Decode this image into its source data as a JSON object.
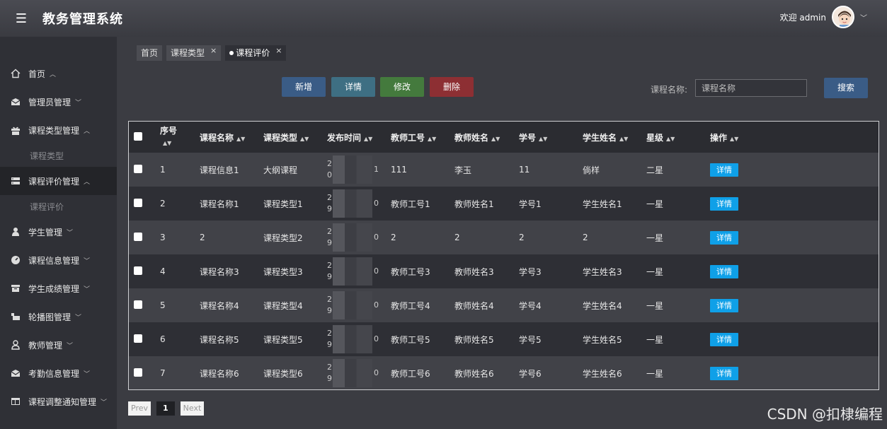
{
  "header": {
    "menu_icon": "hamburger-icon",
    "title": "教务管理系统",
    "welcome": "欢迎 admin"
  },
  "sidebar": {
    "items": [
      {
        "label": "首页",
        "icon": "home-icon",
        "caret": "^"
      },
      {
        "label": "管理员管理",
        "icon": "mail-icon",
        "caret": "v"
      },
      {
        "label": "课程类型管理",
        "icon": "gift-icon",
        "caret": "^"
      },
      {
        "label": "课程类型",
        "sub": true
      },
      {
        "label": "课程评价管理",
        "icon": "server-icon",
        "caret": "^"
      },
      {
        "label": "课程评价",
        "sub": true
      },
      {
        "label": "学生管理",
        "icon": "user-icon",
        "caret": "v"
      },
      {
        "label": "课程信息管理",
        "icon": "gauge-icon",
        "caret": "v"
      },
      {
        "label": "学生成绩管理",
        "icon": "box-icon",
        "caret": "v"
      },
      {
        "label": "轮播图管理",
        "icon": "image-icon",
        "caret": "v"
      },
      {
        "label": "教师管理",
        "icon": "person-icon",
        "caret": "v"
      },
      {
        "label": "考勤信息管理",
        "icon": "mail-icon",
        "caret": "v"
      },
      {
        "label": "课程调整通知管理",
        "icon": "window-icon",
        "caret": "v"
      }
    ]
  },
  "tabs": [
    {
      "label": "首页"
    },
    {
      "label": "课程类型"
    },
    {
      "label": "课程评价"
    }
  ],
  "toolbar": {
    "add": "新增",
    "detail": "详情",
    "edit": "修改",
    "delete": "删除",
    "search_label": "课程名称:",
    "search_placeholder": "课程名称",
    "search": "搜索"
  },
  "table": {
    "headers": [
      "序号",
      "课程名称",
      "课程类型",
      "发布时间",
      "教师工号",
      "教师姓名",
      "学号",
      "学生姓名",
      "星级",
      "操作"
    ],
    "action_label": "详情",
    "rows": [
      {
        "id": "1",
        "course": "课程信息1",
        "type": "大纲课程",
        "time_a": "2",
        "time_b": "0",
        "time_c": "1",
        "tno": "111",
        "tname": "李玉",
        "sno": "11",
        "sname": "倘样",
        "star": "二星"
      },
      {
        "id": "2",
        "course": "课程名称1",
        "type": "课程类型1",
        "time_a": "2",
        "time_b": "9",
        "time_c": "0",
        "tno": "教师工号1",
        "tname": "教师姓名1",
        "sno": "学号1",
        "sname": "学生姓名1",
        "star": "一星"
      },
      {
        "id": "3",
        "course": "2",
        "type": "课程类型2",
        "time_a": "2",
        "time_b": "9",
        "time_c": "0",
        "tno": "2",
        "tname": "2",
        "sno": "2",
        "sname": "2",
        "star": "一星"
      },
      {
        "id": "4",
        "course": "课程名称3",
        "type": "课程类型3",
        "time_a": "2",
        "time_b": "9",
        "time_c": "0",
        "tno": "教师工号3",
        "tname": "教师姓名3",
        "sno": "学号3",
        "sname": "学生姓名3",
        "star": "一星"
      },
      {
        "id": "5",
        "course": "课程名称4",
        "type": "课程类型4",
        "time_a": "2",
        "time_b": "9",
        "time_c": "0",
        "tno": "教师工号4",
        "tname": "教师姓名4",
        "sno": "学号4",
        "sname": "学生姓名4",
        "star": "一星"
      },
      {
        "id": "6",
        "course": "课程名称5",
        "type": "课程类型5",
        "time_a": "2",
        "time_b": "9",
        "time_c": "0",
        "tno": "教师工号5",
        "tname": "教师姓名5",
        "sno": "学号5",
        "sname": "学生姓名5",
        "star": "一星"
      },
      {
        "id": "7",
        "course": "课程名称6",
        "type": "课程类型6",
        "time_a": "2",
        "time_b": "9",
        "time_c": "0",
        "tno": "教师工号6",
        "tname": "教师姓名6",
        "sno": "学号6",
        "sname": "学生姓名6",
        "star": "一星"
      }
    ]
  },
  "pager": {
    "prev": "Prev",
    "current": "1",
    "next": "Next"
  },
  "watermark": "CSDN @扣棣编程"
}
